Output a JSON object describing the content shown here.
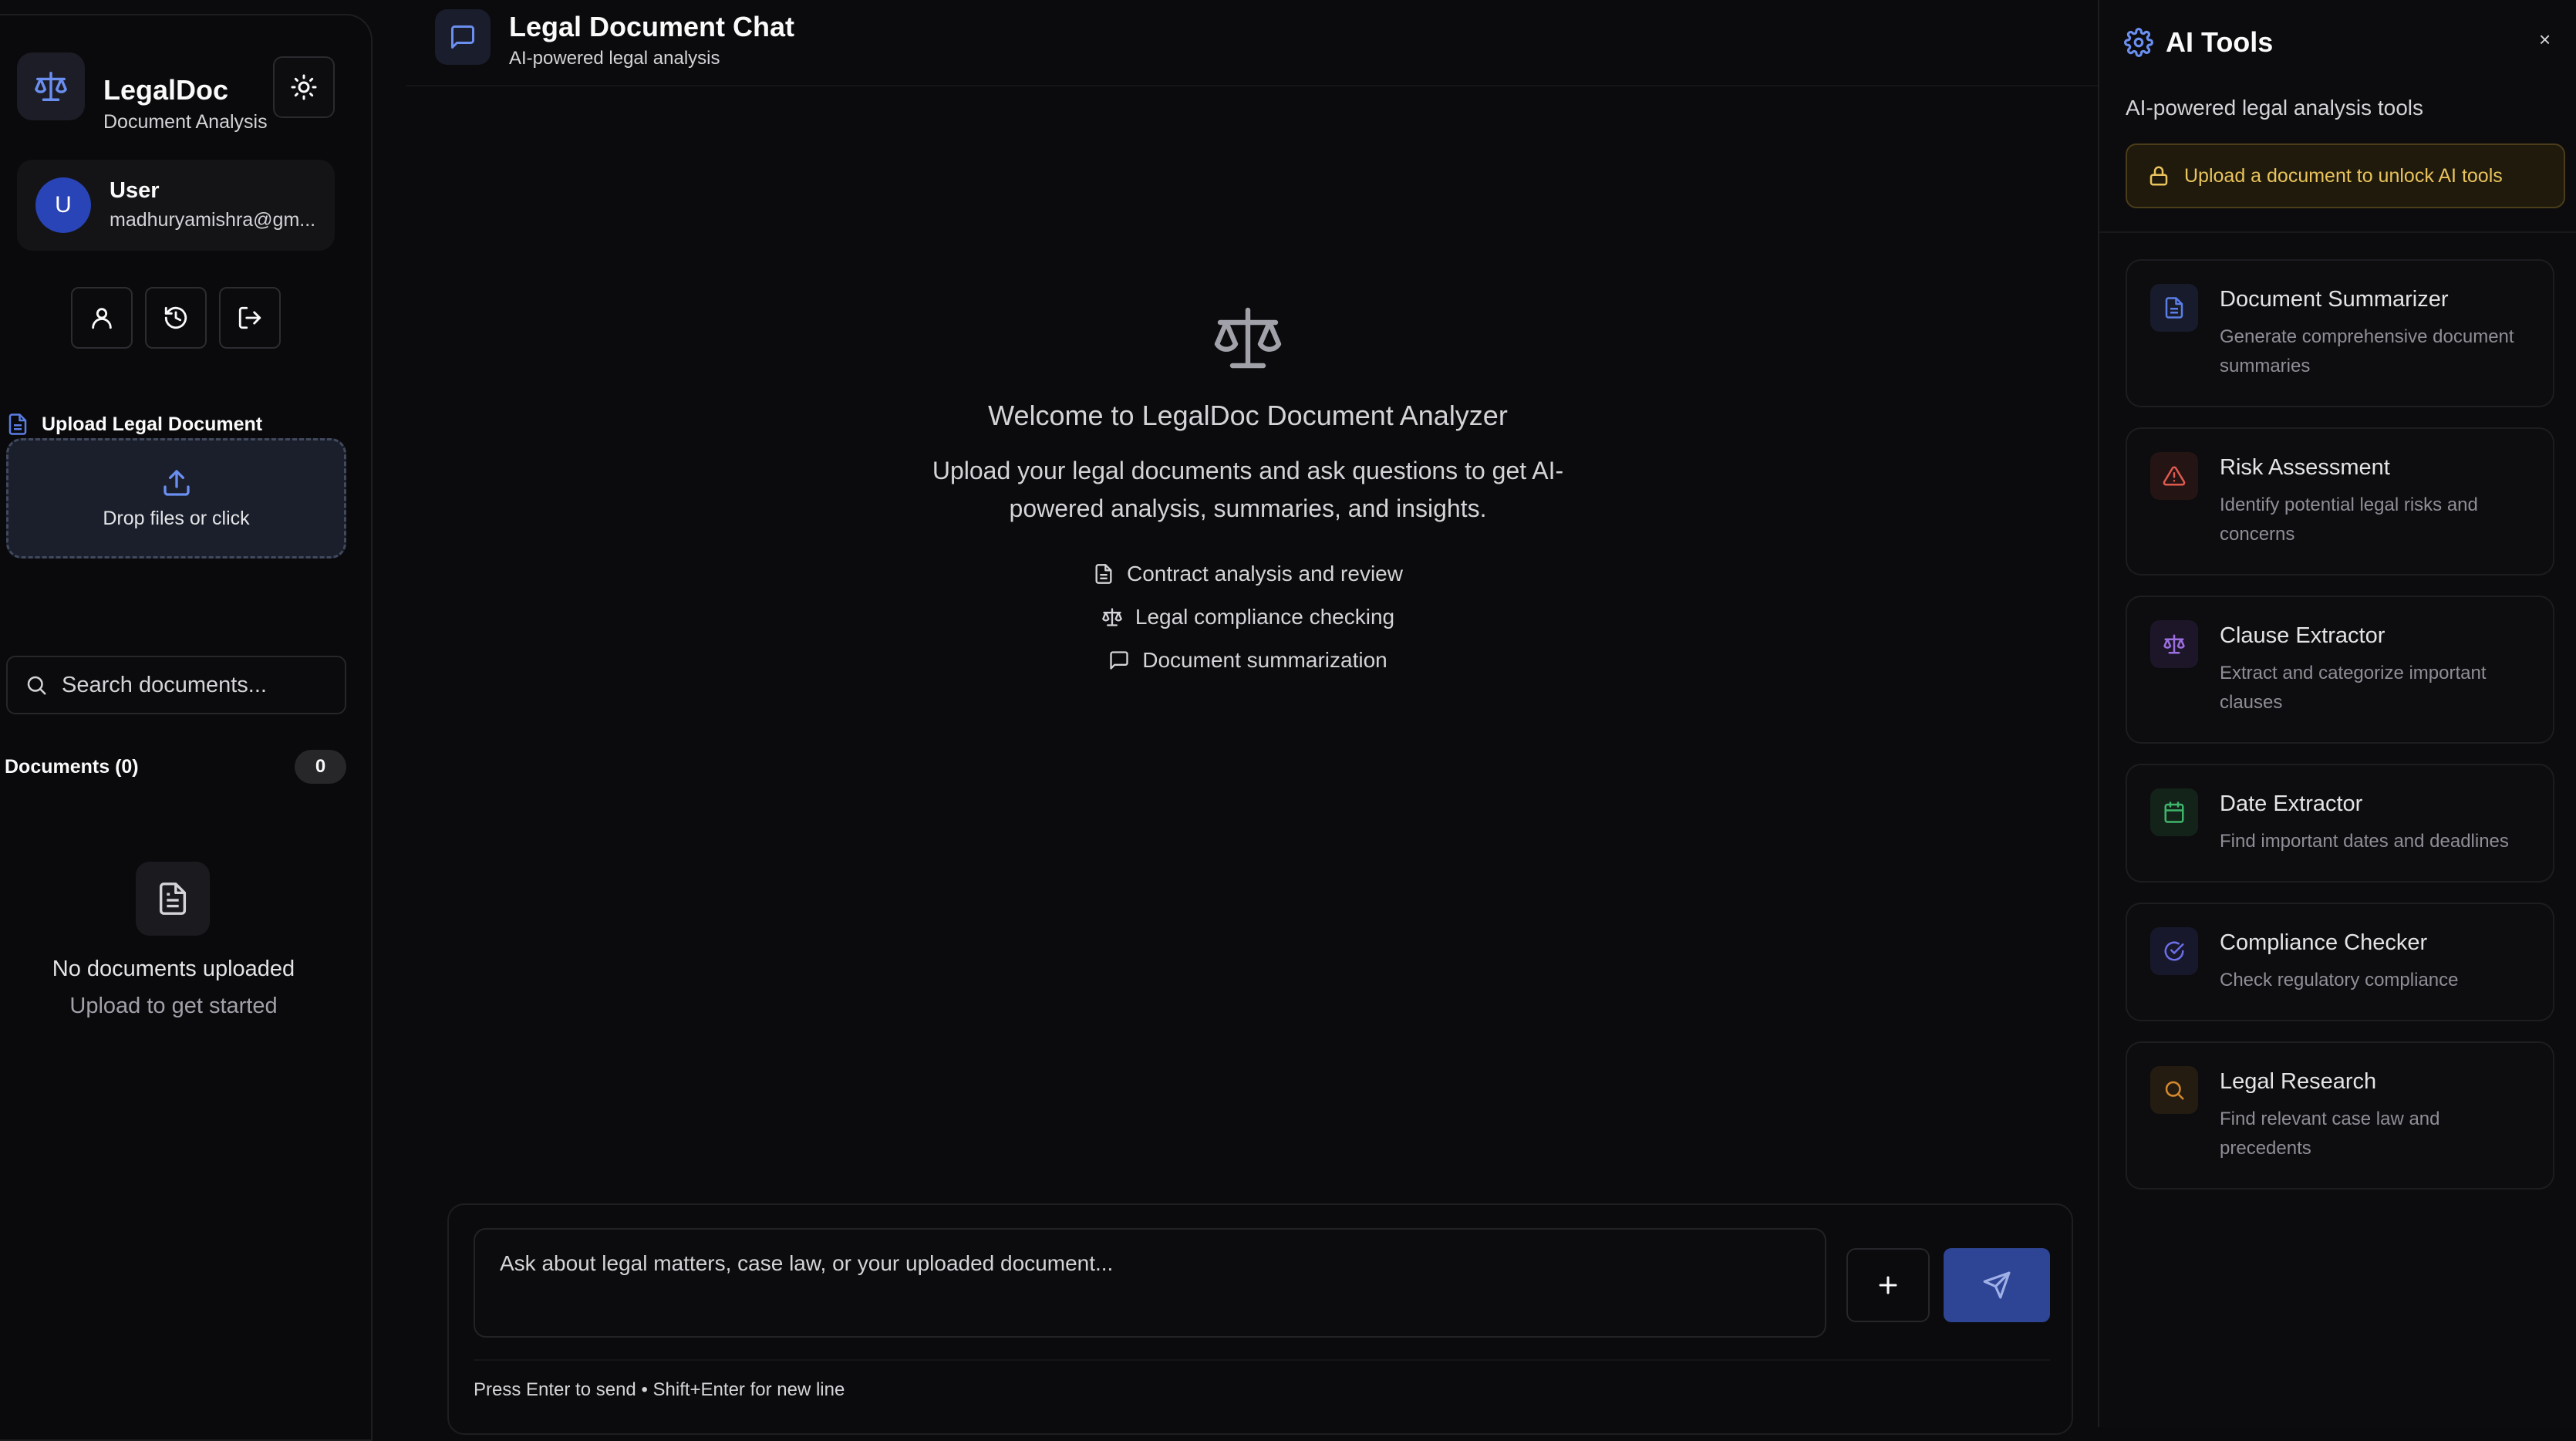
{
  "sidebar": {
    "brand": {
      "name": "LegalDoc",
      "subtitle": "Document Analysis"
    },
    "user": {
      "initial": "U",
      "name": "User",
      "email": "madhuryamishra@gm..."
    },
    "upload": {
      "label": "Upload Legal Document",
      "dropzone_text": "Drop files or click"
    },
    "search": {
      "placeholder": "Search documents..."
    },
    "documents": {
      "label": "Documents (0)",
      "count": "0"
    },
    "empty": {
      "title": "No documents uploaded",
      "subtitle": "Upload to get started"
    }
  },
  "header": {
    "title": "Legal Document Chat",
    "subtitle": "AI-powered legal analysis"
  },
  "welcome": {
    "title": "Welcome to LegalDoc Document Analyzer",
    "description": "Upload your legal documents and ask questions to get AI-powered analysis, summaries, and insights.",
    "features": [
      {
        "icon": "document-icon",
        "label": "Contract analysis and review"
      },
      {
        "icon": "scale-icon",
        "label": "Legal compliance checking"
      },
      {
        "icon": "chat-bubble-icon",
        "label": "Document summarization"
      }
    ]
  },
  "composer": {
    "placeholder": "Ask about legal matters, case law, or your uploaded document...",
    "hint": "Press Enter to send • Shift+Enter for new line"
  },
  "tools": {
    "title": "AI Tools",
    "close": "×",
    "subtitle": "AI-powered legal analysis tools",
    "unlock_notice": "Upload a document to unlock AI tools",
    "items": [
      {
        "title": "Document Summarizer",
        "description": "Generate comprehensive document summaries",
        "icon": "document-icon",
        "color": "#5b7ee5"
      },
      {
        "title": "Risk Assessment",
        "description": "Identify potential legal risks and concerns",
        "icon": "warning-icon",
        "color": "#e05a4f"
      },
      {
        "title": "Clause Extractor",
        "description": "Extract and categorize important clauses",
        "icon": "scale-icon",
        "color": "#9b6fe0"
      },
      {
        "title": "Date Extractor",
        "description": "Find important dates and deadlines",
        "icon": "calendar-icon",
        "color": "#3fb56b"
      },
      {
        "title": "Compliance Checker",
        "description": "Check regulatory compliance",
        "icon": "check-circle-icon",
        "color": "#6b6fe8"
      },
      {
        "title": "Legal Research",
        "description": "Find relevant case law and precedents",
        "icon": "search-icon",
        "color": "#d68a2e"
      }
    ]
  },
  "colors": {
    "accent": "#2e4596",
    "avatar": "#2844b6",
    "warning_text": "#e9c35c",
    "background": "#0b0b0d"
  }
}
